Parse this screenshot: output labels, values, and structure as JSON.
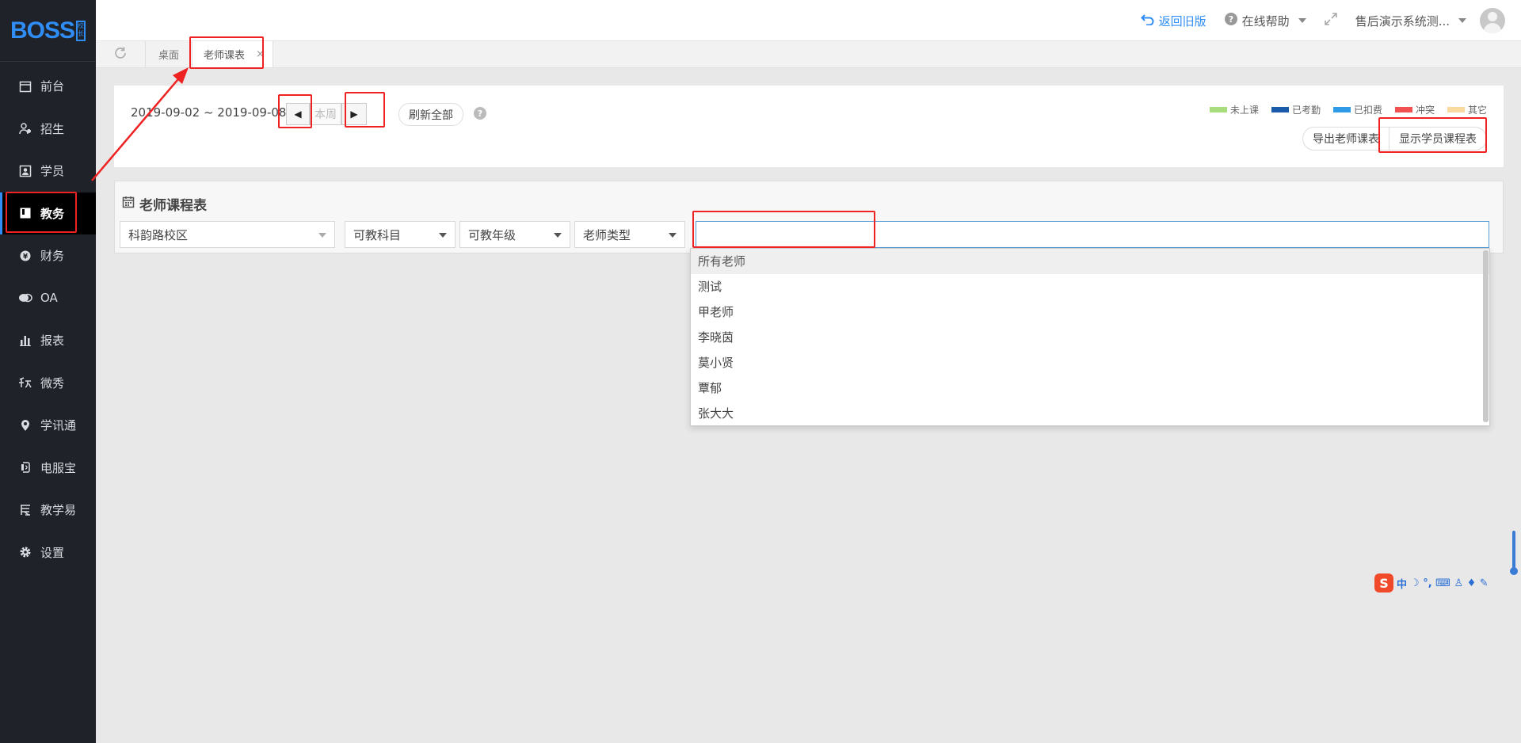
{
  "sidebar": {
    "logo_text": "BOSS",
    "logo_badge": "校长",
    "items": [
      {
        "label": "前台",
        "icon": "calendar-icon"
      },
      {
        "label": "招生",
        "icon": "user-add-icon"
      },
      {
        "label": "学员",
        "icon": "student-card-icon"
      },
      {
        "label": "教务",
        "icon": "book-icon",
        "active": true
      },
      {
        "label": "财务",
        "icon": "yen-icon"
      },
      {
        "label": "OA",
        "icon": "chat-icon"
      },
      {
        "label": "报表",
        "icon": "bar-chart-icon"
      },
      {
        "label": "微秀",
        "icon": "show-icon"
      },
      {
        "label": "学讯通",
        "icon": "location-pin-icon"
      },
      {
        "label": "电服宝",
        "icon": "phone-service-icon"
      },
      {
        "label": "教学易",
        "icon": "teaching-icon"
      },
      {
        "label": "设置",
        "icon": "gear-icon"
      }
    ]
  },
  "header": {
    "back_old": "返回旧版",
    "help": "在线帮助",
    "user": "售后演示系统测..."
  },
  "tabs": {
    "desk": "桌面",
    "current": "老师课表",
    "close": "×"
  },
  "toolbar": {
    "date_range": "2019-09-02 ~ 2019-09-08",
    "prev": "◀",
    "this_week": "本周",
    "next": "▶",
    "refresh_all": "刷新全部",
    "help_mark": "?"
  },
  "legend": [
    {
      "label": "未上课",
      "color": "#a8dd7c"
    },
    {
      "label": "已考勤",
      "color": "#1a5aa8"
    },
    {
      "label": "已扣费",
      "color": "#2f9be6"
    },
    {
      "label": "冲突",
      "color": "#f05050"
    },
    {
      "label": "其它",
      "color": "#f9d9a0"
    }
  ],
  "actions": {
    "export": "导出老师课表",
    "show_student": "显示学员课程表"
  },
  "section": {
    "title": "老师课程表"
  },
  "filters": {
    "campus": "科韵路校区",
    "subject": "可教科目",
    "grade": "可教年级",
    "teacher_type": "老师类型",
    "teacher_value": ""
  },
  "teacher_dropdown": {
    "options": [
      "所有老师",
      "测试",
      "甲老师",
      "李晓茵",
      "莫小贤",
      "覃郁",
      "张大大"
    ],
    "highlighted": 0
  },
  "ime": {
    "logo": "S",
    "mode": "中",
    "symbols": "☽ °, ⌨ ♙ ♦ ✎"
  }
}
